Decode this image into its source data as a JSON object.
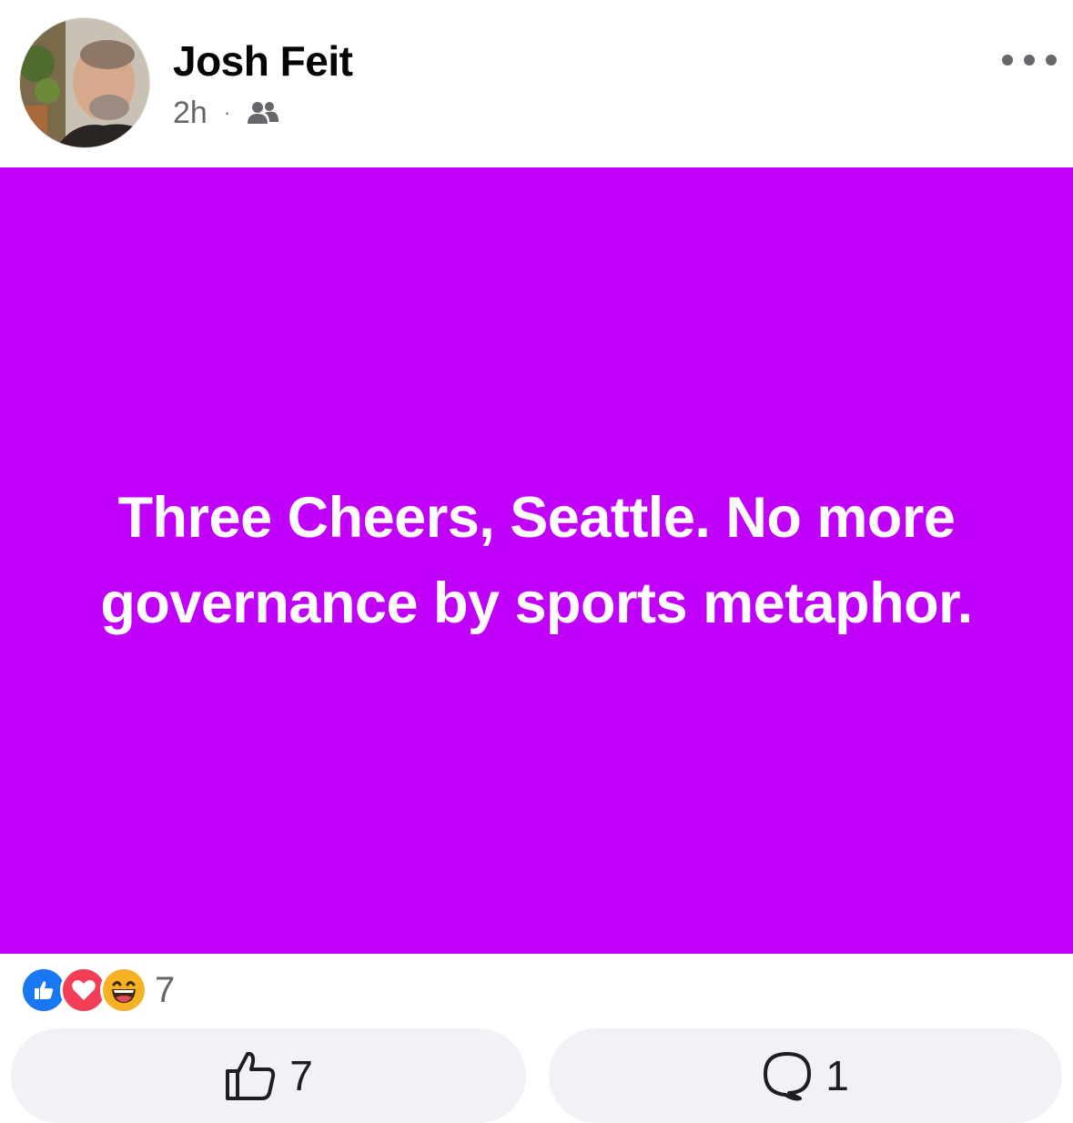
{
  "post": {
    "author": "Josh Feit",
    "time": "2h",
    "separator": "·",
    "audience_icon": "friends-icon",
    "text": "Three Cheers, Seattle. No more governance by sports metaphor.",
    "background_color": "#c000fa"
  },
  "reactions": {
    "icons": [
      "like-reaction-icon",
      "love-reaction-icon",
      "haha-reaction-icon"
    ],
    "count": "7"
  },
  "actions": {
    "like_count": "7",
    "comment_count": "1"
  },
  "colors": {
    "like_blue": "#1877f2",
    "love_red": "#f33e58",
    "haha_yellow": "#f7b125",
    "muted": "#65676b"
  }
}
